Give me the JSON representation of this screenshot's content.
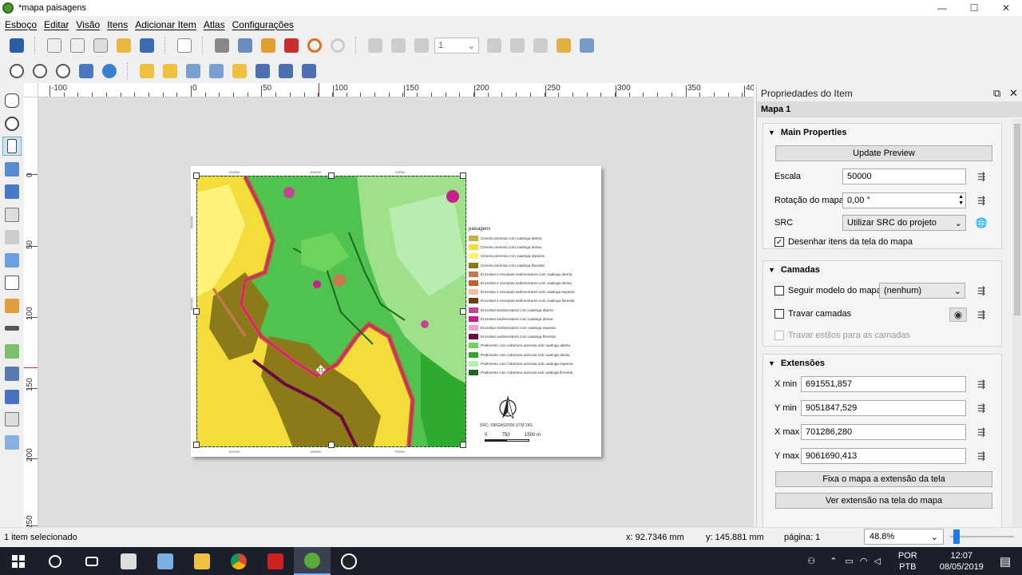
{
  "window": {
    "title": "*mapa paisagens",
    "min": "—",
    "max": "☐",
    "close": "✕"
  },
  "menu": [
    "Esboço",
    "Editar",
    "Visão",
    "Itens",
    "Adicionar Item",
    "Atlas",
    "Configurações"
  ],
  "toolbar": {
    "page_value": "1"
  },
  "ruler": {
    "h_labels": [
      "-100",
      "0",
      "50",
      "100",
      "150",
      "200",
      "250",
      "300",
      "350",
      "40"
    ],
    "v_labels": [
      "0",
      "50",
      "100",
      "150",
      "200",
      "250"
    ]
  },
  "layout": {
    "legend_title": "paisagens",
    "legend": [
      {
        "label": "Cimeira arenosa com caatinga aberta",
        "color": "#c8b03a"
      },
      {
        "label": "Cimeira arenosa com caatinga densa",
        "color": "#f4dc3a"
      },
      {
        "label": "Cimeira arenosa com caatinga esparsa",
        "color": "#fff27a"
      },
      {
        "label": "Cimeira arenosa com caatinga florestal",
        "color": "#8a7a1a"
      },
      {
        "label": "Encostas e escarpas sedimentares com caatinga aberta",
        "color": "#c87850"
      },
      {
        "label": "Encostas e escarpas sedimentares com caatinga densa",
        "color": "#c0602a"
      },
      {
        "label": "Encostas e escarpas sedimentares com caatinga esparsa",
        "color": "#f0c0a0"
      },
      {
        "label": "Encostas e escarpas sedimentares com caatinga florestal",
        "color": "#6a3a10"
      },
      {
        "label": "Encostas sedimentares com caatinga aberta",
        "color": "#c04890"
      },
      {
        "label": "Encostas sedimentares com caatinga densa",
        "color": "#c81e8c"
      },
      {
        "label": "Encostas sedimentares com caatinga esparsa",
        "color": "#f0a0d8"
      },
      {
        "label": "Encostas sedimentares com caatinga florestal",
        "color": "#6a0a40"
      },
      {
        "label": "Pedimento com cobertura arenosa sob caatinga aberta",
        "color": "#6cd45a"
      },
      {
        "label": "Pedimento com cobertura arenosa sob caatinga densa",
        "color": "#2eaa2e"
      },
      {
        "label": "Pedimento com cobertura arenosa sob caatinga esparsa",
        "color": "#b8ecb0"
      },
      {
        "label": "Pedimento com cobertura arenosa sob caatinga florestal",
        "color": "#1a6a1a"
      }
    ],
    "src_text": "SRC: SIRGAS2000 UTM 24S",
    "scale_labels": [
      "0",
      "750",
      "1500 m"
    ],
    "grid_top": [
      "692000",
      "696000",
      "700000"
    ],
    "grid_bottom": [
      "692000",
      "696000",
      "700000"
    ],
    "grid_left": [
      "9058000",
      "9054000"
    ]
  },
  "panel": {
    "title": "Propriedades do Item",
    "subtitle": "Mapa 1",
    "main_properties": "Main Properties",
    "update_preview": "Update Preview",
    "escala_label": "Escala",
    "escala_value": "50000",
    "rotacao_label": "Rotação do mapa",
    "rotacao_value": "0,00 °",
    "src_label": "SRC",
    "src_value": "Utilizar SRC do projeto",
    "desenhar_label": "Desenhar itens da tela do mapa",
    "desenhar_checked": true,
    "camadas": "Camadas",
    "seguir_label": "Seguir modelo do mapa",
    "seguir_value": "(nenhum)",
    "travar_label": "Travar camadas",
    "travar_estilos_label": "Travar estilos para as camadas",
    "extensoes": "Extensões",
    "xmin_label": "X min",
    "xmin_value": "691551,857",
    "ymin_label": "Y min",
    "ymin_value": "9051847,529",
    "xmax_label": "X max",
    "xmax_value": "701286,280",
    "ymax_label": "Y max",
    "ymax_value": "9061690,413",
    "fixa_btn": "Fixa o mapa a extensão da tela",
    "ver_btn": "Ver extensão na tela do mapa"
  },
  "status": {
    "selection": "1 item selecionado",
    "x": "x: 92.7346 mm",
    "y": "y: 145.881 mm",
    "page": "página: 1",
    "zoom": "48.8%",
    "zoom_fraction": 0.05
  },
  "taskbar": {
    "lang1": "POR",
    "lang2": "PTB",
    "time": "12:07",
    "date": "08/05/2019"
  }
}
